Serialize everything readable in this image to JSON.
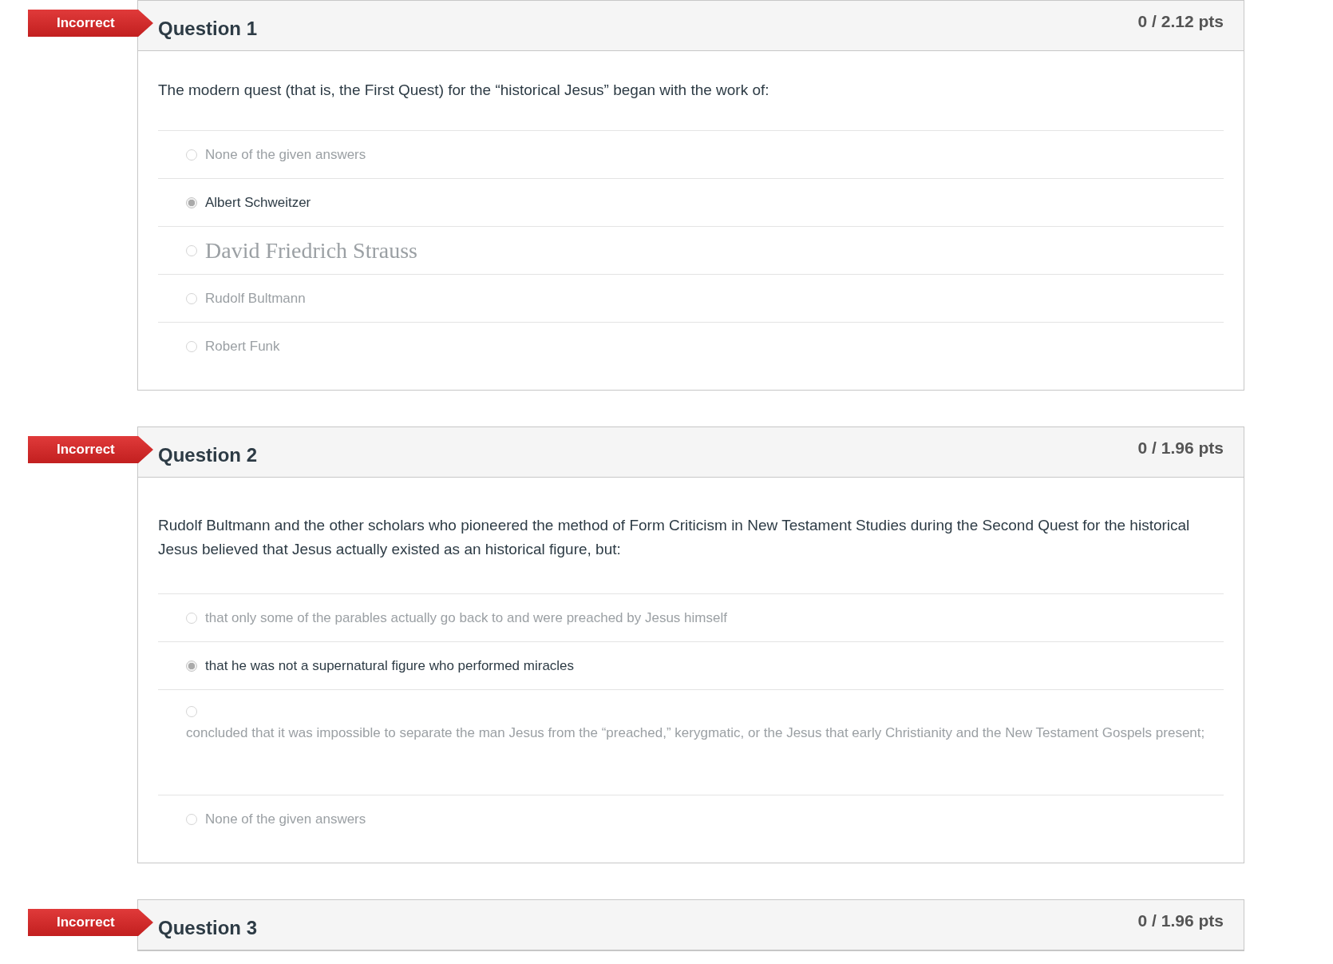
{
  "questions": [
    {
      "status": "Incorrect",
      "title": "Question 1",
      "points": "0 / 2.12 pts",
      "text": "The modern quest (that is, the First Quest) for the “historical Jesus” began with the work of:",
      "answers": [
        {
          "kind": "plain",
          "label": "None of the given answers",
          "selected": false
        },
        {
          "kind": "plain",
          "label": "Albert Schweitzer",
          "selected": true
        },
        {
          "kind": "serif",
          "label": "David Friedrich Strauss",
          "selected": false
        },
        {
          "kind": "plain",
          "label": "Rudolf Bultmann",
          "selected": false
        },
        {
          "kind": "plain",
          "label": "Robert Funk",
          "selected": false
        }
      ]
    },
    {
      "status": "Incorrect",
      "title": "Question 2",
      "points": "0 / 1.96 pts",
      "text": "Rudolf Bultmann and the other scholars who pioneered the method of Form Criticism in New Testament Studies during the Second Quest for the historical Jesus believed that Jesus actually existed as an historical figure, but:",
      "answers": [
        {
          "kind": "plain",
          "label": "that only some of the parables actually go back to and were preached by Jesus himself",
          "selected": false
        },
        {
          "kind": "plain",
          "label": "that he was not a supernatural figure who performed miracles",
          "selected": true
        },
        {
          "kind": "stacked",
          "label": "concluded that it was impossible to separate the man Jesus from the “preached,” kerygmatic, or the Jesus that early Christianity and the New Testament Gospels present;",
          "selected": false
        },
        {
          "kind": "plain",
          "label": "None of the given answers",
          "selected": false
        }
      ]
    },
    {
      "status": "Incorrect",
      "title": "Question 3",
      "points": "0 / 1.96 pts"
    }
  ]
}
